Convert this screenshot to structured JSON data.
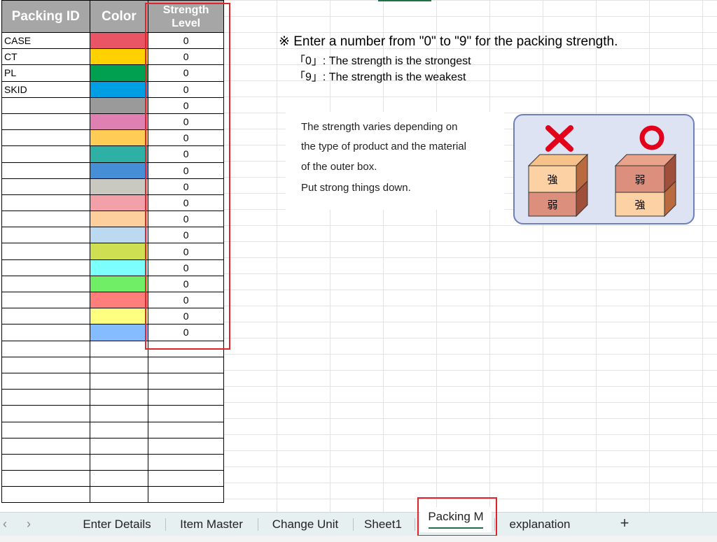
{
  "table": {
    "headers": {
      "id": "Packing ID",
      "color": "Color",
      "level_line1": "Strength",
      "level_line2": "Level"
    },
    "rows": [
      {
        "id": "CASE",
        "color": "#e95565",
        "level": "0"
      },
      {
        "id": "CT",
        "color": "#ffd100",
        "level": "0"
      },
      {
        "id": "PL",
        "color": "#00a051",
        "level": "0"
      },
      {
        "id": "SKID",
        "color": "#009fe3",
        "level": "0"
      },
      {
        "id": "",
        "color": "#9a9a9a",
        "level": "0"
      },
      {
        "id": "",
        "color": "#df80b2",
        "level": "0"
      },
      {
        "id": "",
        "color": "#ffcc55",
        "level": "0"
      },
      {
        "id": "",
        "color": "#2eb0a5",
        "level": "0"
      },
      {
        "id": "",
        "color": "#468ed5",
        "level": "0"
      },
      {
        "id": "",
        "color": "#c9c8c1",
        "level": "0"
      },
      {
        "id": "",
        "color": "#f3a1a8",
        "level": "0"
      },
      {
        "id": "",
        "color": "#fccf9c",
        "level": "0"
      },
      {
        "id": "",
        "color": "#bcd9f2",
        "level": "0"
      },
      {
        "id": "",
        "color": "#cee052",
        "level": "0"
      },
      {
        "id": "",
        "color": "#7dffff",
        "level": "0"
      },
      {
        "id": "",
        "color": "#70ee66",
        "level": "0"
      },
      {
        "id": "",
        "color": "#ff7d7b",
        "level": "0"
      },
      {
        "id": "",
        "color": "#fefe80",
        "level": "0"
      },
      {
        "id": "",
        "color": "#84bcff",
        "level": "0"
      }
    ],
    "empty_rows": 10
  },
  "note": {
    "heading": "※ Enter a number from \"0\" to \"9\" for the packing strength.",
    "line0": "「0」: The strength is the strongest",
    "line9": "「9」: The strength is the weakest"
  },
  "explain": {
    "line1": "The strength varies depending on",
    "line2": "the type of product and the material",
    "line3": "of the outer box.",
    "line4": "Put strong things down."
  },
  "illustration": {
    "strong": "強",
    "weak": "弱",
    "wrong_icon": "cross-mark-icon",
    "right_icon": "circle-mark-icon",
    "wrong_color": "#e3001b",
    "right_color": "#e3001b"
  },
  "tabs": {
    "prev": "‹",
    "next": "›",
    "items": [
      "Enter Details",
      "Item Master",
      "Change Unit",
      "Sheet1",
      "Packing M",
      "explanation"
    ],
    "active": "Packing M",
    "add": "+"
  }
}
